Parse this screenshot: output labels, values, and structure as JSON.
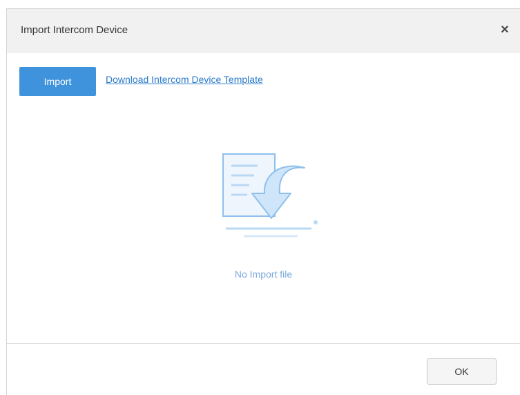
{
  "dialog": {
    "title": "Import Intercom Device",
    "close_icon": "close-icon",
    "close_glyph": "×"
  },
  "toolbar": {
    "import_label": "Import",
    "template_link": "Download Intercom Device Template"
  },
  "empty_state": {
    "illustration_icon": "import-file-icon",
    "message": "No Import file"
  },
  "footer": {
    "ok_label": "OK"
  },
  "colors": {
    "accent": "#3f93dc",
    "link": "#2a7ac9",
    "empty_text": "#7aa8dc",
    "illustration": "#8ec0ec"
  }
}
